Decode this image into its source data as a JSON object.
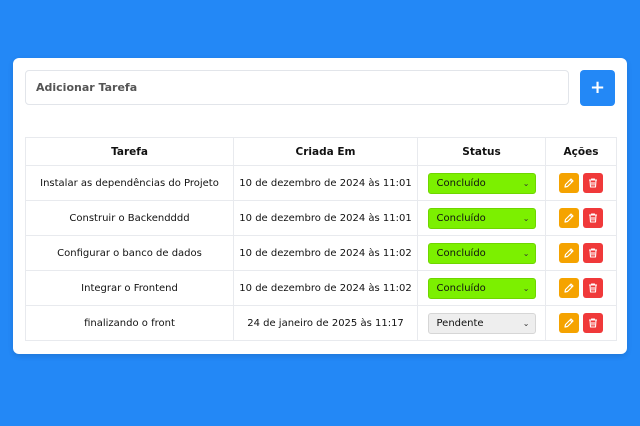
{
  "task_input": {
    "placeholder": "Adicionar Tarefa"
  },
  "add_button": {
    "label": "+"
  },
  "table": {
    "headers": [
      "Tarefa",
      "Criada Em",
      "Status",
      "Ações"
    ],
    "rows": [
      {
        "tarefa": "Instalar as dependências do Projeto",
        "criada_em": "10 de dezembro de 2024 às 11:01",
        "status": "Concluído"
      },
      {
        "tarefa": "Construir o Backendddd",
        "criada_em": "10 de dezembro de 2024 às 11:01",
        "status": "Concluído"
      },
      {
        "tarefa": "Configurar o banco de dados",
        "criada_em": "10 de dezembro de 2024 às 11:02",
        "status": "Concluído"
      },
      {
        "tarefa": "Integrar o Frontend",
        "criada_em": "10 de dezembro de 2024 às 11:02",
        "status": "Concluído"
      },
      {
        "tarefa": "finalizando o front",
        "criada_em": "24 de janeiro de 2025 às 11:17",
        "status": "Pendente"
      }
    ]
  },
  "icons": {
    "edit": "pencil-icon",
    "delete": "trash-icon",
    "dropdown": "chevron-down-icon"
  },
  "colors": {
    "background": "#2388f6",
    "done": "#7cf000",
    "pending": "#eeeeee",
    "edit": "#f5a300",
    "delete": "#f0393a"
  }
}
